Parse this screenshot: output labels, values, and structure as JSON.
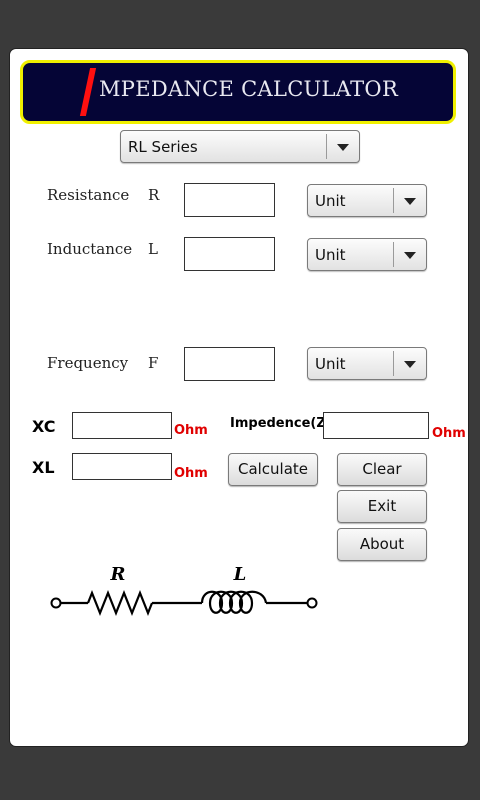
{
  "banner": {
    "title": "MPEDANCE CALCULATOR"
  },
  "circuit_type": {
    "selected": "RL Series"
  },
  "rows": {
    "resistance": {
      "label": "Resistance",
      "symbol": "R",
      "value": "",
      "unit": "Unit"
    },
    "inductance": {
      "label": "Inductance",
      "symbol": "L",
      "value": "",
      "unit": "Unit"
    },
    "frequency": {
      "label": "Frequency",
      "symbol": "F",
      "value": "",
      "unit": "Unit"
    }
  },
  "results": {
    "xc": {
      "label": "XC",
      "value": "",
      "unit": "Ohm"
    },
    "xl": {
      "label": "XL",
      "value": "",
      "unit": "Ohm"
    },
    "impedance": {
      "label": "Impedence(Z)",
      "value": "",
      "unit": "Ohm"
    }
  },
  "buttons": {
    "calculate": "Calculate",
    "clear": "Clear",
    "exit": "Exit",
    "about": "About"
  },
  "circuit": {
    "r_label": "R",
    "l_label": "L"
  },
  "colors": {
    "banner_bg": "#050536",
    "banner_border": "#f0f000",
    "accent_red": "#e00000"
  }
}
